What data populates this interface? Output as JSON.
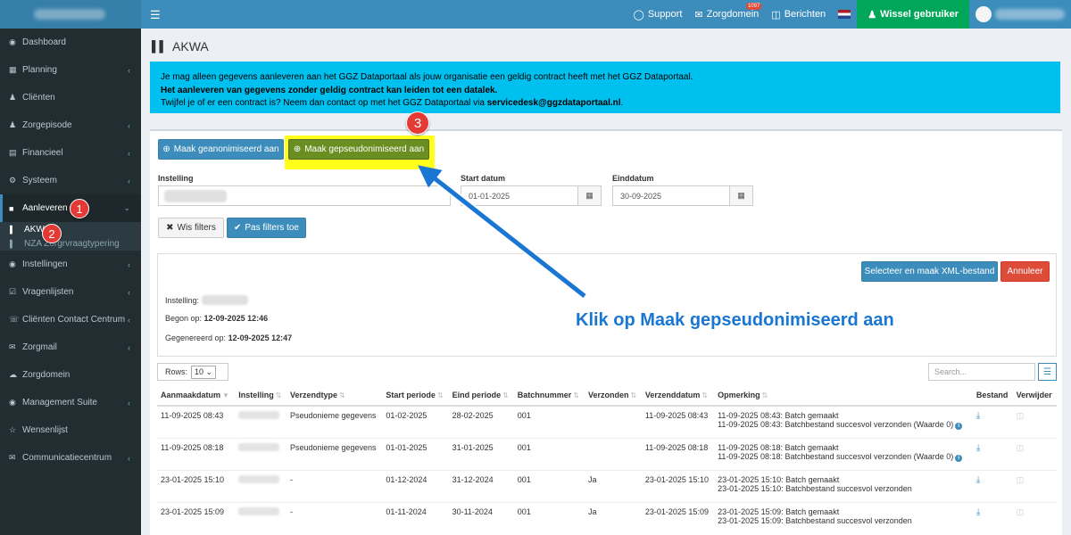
{
  "topnav": {
    "menu_icon": "hamburger-icon",
    "support": "Support",
    "zorgdomein": "Zorgdomein",
    "zorgdomein_badge": "1097",
    "berichten": "Berichten",
    "wissel": "Wissel gebruiker"
  },
  "sidebar": {
    "items": [
      {
        "label": "Dashboard",
        "icon": "dashboard-icon"
      },
      {
        "label": "Planning",
        "icon": "calendar-icon"
      },
      {
        "label": "Cliënten",
        "icon": "user-icon"
      },
      {
        "label": "Zorgepisode",
        "icon": "user-icon"
      },
      {
        "label": "Financieel",
        "icon": "table-icon"
      },
      {
        "label": "Systeem",
        "icon": "gear-icon"
      },
      {
        "label": "Aanleveren",
        "icon": "truck-icon"
      },
      {
        "label": "Instellingen",
        "icon": "globe-icon"
      },
      {
        "label": "Vragenlijsten",
        "icon": "checklist-icon"
      },
      {
        "label": "Cliënten Contact Centrum",
        "icon": "phone-icon"
      },
      {
        "label": "Zorgmail",
        "icon": "envelope-icon"
      },
      {
        "label": "Zorgdomein",
        "icon": "cloud-icon"
      },
      {
        "label": "Management Suite",
        "icon": "globe-icon"
      },
      {
        "label": "Wensenlijst",
        "icon": "star-icon"
      },
      {
        "label": "Communicatiecentrum",
        "icon": "envelope-icon"
      }
    ],
    "sub": [
      {
        "label": "AKWA"
      },
      {
        "label": "NZA Zorgrvraagtypering"
      }
    ]
  },
  "markers": [
    "1",
    "2",
    "3"
  ],
  "page": {
    "title": "AKWA"
  },
  "callout": {
    "line1": "Je mag alleen gegevens aanleveren aan het GGZ Dataportaal als jouw organisatie een geldig contract heeft met het GGZ Dataportaal.",
    "line2": "Het aanleveren van gegevens zonder geldig contract kan leiden tot een datalek.",
    "line3_prefix": "Twijfel je of er een contract is? Neem dan contact op met het GGZ Dataportaal via ",
    "line3_email": "servicedesk@ggzdataportaal.nl",
    "line3_suffix": "."
  },
  "buttons": {
    "geanonimiseerd": "Maak geanonimiseerd aan",
    "gepseudonimiseerd": "Maak gepseudonimiseerd aan",
    "wis_filters": "Wis filters",
    "pas_filters": "Pas filters toe",
    "selecteer_xml": "Selecteer en maak XML-bestand",
    "annuleer": "Annuleer"
  },
  "filters": {
    "instelling_label": "Instelling",
    "start_label": "Start datum",
    "start_value": "01-01-2025",
    "eind_label": "Einddatum",
    "eind_value": "30-09-2025"
  },
  "panel": {
    "instelling_label": "Instelling:",
    "begon_label": "Begon op: ",
    "begon_value": "12-09-2025 12:46",
    "gegenereerd_label": "Gegenereerd op: ",
    "gegenereerd_value": "12-09-2025 12:47"
  },
  "annotation": "Klik op Maak gepseudonimiseerd aan",
  "table_controls": {
    "rows_label": "Rows:",
    "rows_value": "10",
    "search_placeholder": "Search..."
  },
  "table": {
    "headers": [
      "Aanmaakdatum",
      "Instelling",
      "Verzendtype",
      "Start periode",
      "Eind periode",
      "Batchnummer",
      "Verzonden",
      "Verzenddatum",
      "Opmerking",
      "Bestand",
      "Verwijder"
    ],
    "rows": [
      {
        "aanmaak": "11-09-2025 08:43",
        "verzendtype": "Pseudoniеme gegevens",
        "start": "01-02-2025",
        "eind": "28-02-2025",
        "batch": "001",
        "verzonden": "",
        "verzenddatum": "11-09-2025 08:43",
        "opm1": "11-09-2025 08:43: Batch gemaakt",
        "opm2": "11-09-2025 08:43: Batchbestand succesvol verzonden (Waarde 0)"
      },
      {
        "aanmaak": "11-09-2025 08:18",
        "verzendtype": "Pseudoniеme gegevens",
        "start": "01-01-2025",
        "eind": "31-01-2025",
        "batch": "001",
        "verzonden": "",
        "verzenddatum": "11-09-2025 08:18",
        "opm1": "11-09-2025 08:18: Batch gemaakt",
        "opm2": "11-09-2025 08:18: Batchbestand succesvol verzonden (Waarde 0)"
      },
      {
        "aanmaak": "23-01-2025 15:10",
        "verzendtype": "-",
        "start": "01-12-2024",
        "eind": "31-12-2024",
        "batch": "001",
        "verzonden": "Ja",
        "verzenddatum": "23-01-2025 15:10",
        "opm1": "23-01-2025 15:10: Batch gemaakt",
        "opm2": "23-01-2025 15:10: Batchbestand succesvol verzonden"
      },
      {
        "aanmaak": "23-01-2025 15:09",
        "verzendtype": "-",
        "start": "01-11-2024",
        "eind": "30-11-2024",
        "batch": "001",
        "verzonden": "Ja",
        "verzenddatum": "23-01-2025 15:09",
        "opm1": "23-01-2025 15:09: Batch gemaakt",
        "opm2": "23-01-2025 15:09: Batchbestand succesvol verzonden"
      }
    ]
  },
  "colors": {
    "topbar": "#3c8dbc",
    "sidebar": "#222d32",
    "callout": "#00c0ef",
    "highlight": "#ffff00",
    "olive_button": "#6b8e23",
    "wissel": "#00a65a",
    "marker": "#e53935",
    "arrow": "#1976d2"
  }
}
